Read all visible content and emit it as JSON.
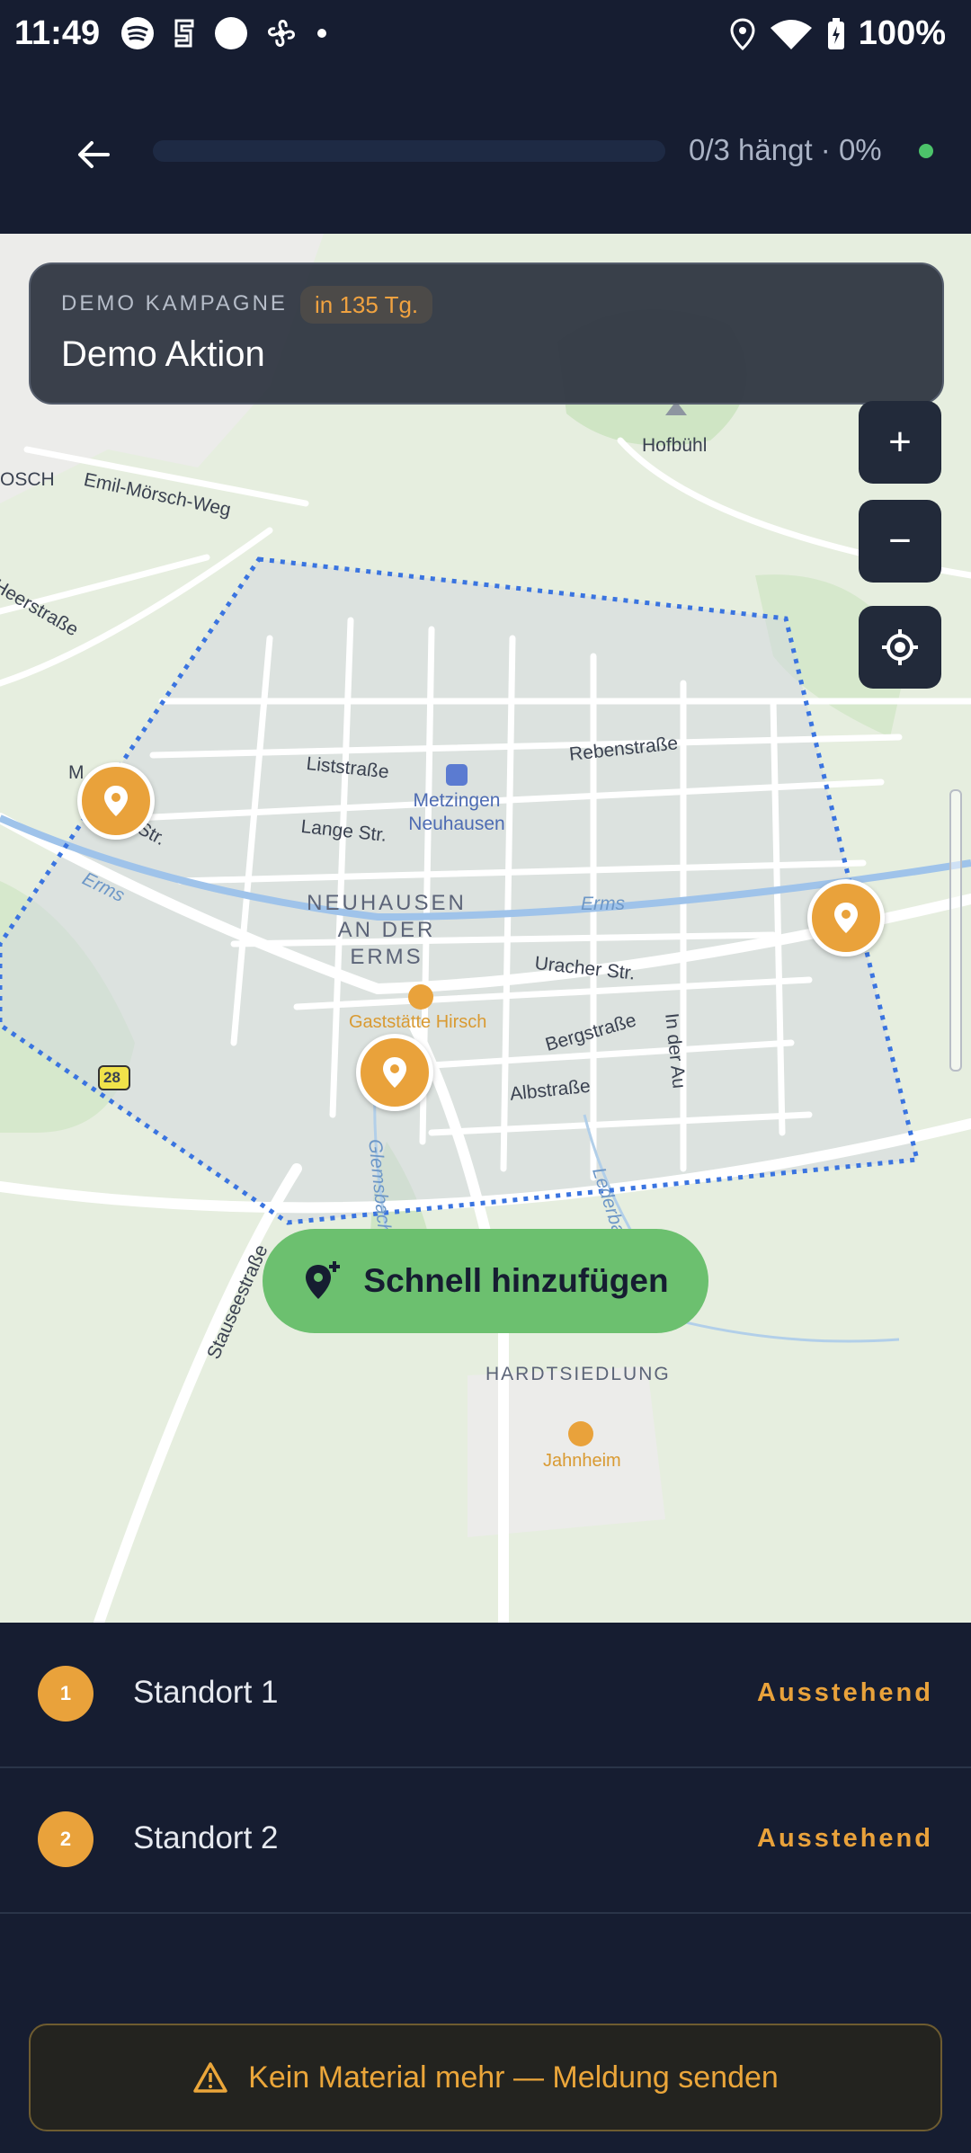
{
  "status_bar": {
    "time": "11:49",
    "battery_text": "100%",
    "left_icons": [
      "spotify-icon",
      "app-icon",
      "circle-icon",
      "fan-icon",
      "dot-icon"
    ],
    "right_icons": [
      "location-icon",
      "wifi-icon",
      "battery-icon"
    ]
  },
  "header": {
    "progress_text": "0/3 hängt · 0%",
    "progress_fraction": 0,
    "status_color": "#4cc36a"
  },
  "campaign": {
    "tag": "DEMO KAMPAGNE",
    "due_badge": "in 135 Tg.",
    "title": "Demo Aktion"
  },
  "map": {
    "labels": {
      "emil": "Emil-Mörsch-Weg",
      "heer": "Heerstraße",
      "osch": "OSCH",
      "hofbuhl": "Hofbühl",
      "liststr": "Liststraße",
      "rebenstr": "Rebenstraße",
      "langestr": "Lange Str.",
      "mstr": "M",
      "strsuffix": "Str.",
      "erms_left": "Erms",
      "erms_center": "Erms",
      "uracher": "Uracher Str.",
      "bergstr": "Bergstraße",
      "inderau": "In der Au",
      "albstr": "Albstraße",
      "stauseestr": "Stauseestraße",
      "glemsbach": "Glemsbach",
      "lederbach": "Lederbach",
      "road_number": "28"
    },
    "station": "Metzingen\nNeuhausen",
    "town": "NEUHAUSEN\nAN DER\nERMS",
    "poi": "Gaststätte Hirsch",
    "hardt": "HARDTSIEDLUNG",
    "jahnheim": "Jahnheim",
    "zoom_in": "+",
    "zoom_out": "−"
  },
  "quick_add": {
    "label": "Schnell hinzufügen"
  },
  "locations": [
    {
      "number": "1",
      "name": "Standort 1",
      "status": "Ausstehend"
    },
    {
      "number": "2",
      "name": "Standort 2",
      "status": "Ausstehend"
    }
  ],
  "alert": {
    "label": "Kein Material mehr — Meldung senden"
  },
  "colors": {
    "background": "#161d31",
    "accent_orange": "#e9a23b",
    "quick_add_green": "#6cc06f",
    "boundary_blue": "#3a74e0"
  }
}
